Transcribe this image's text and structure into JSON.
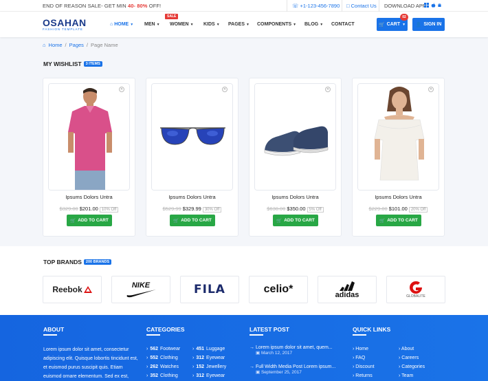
{
  "topbar": {
    "promo_prefix": "END OF REASON SALE- GET MIN",
    "promo_min": "40-",
    "promo_max": "80%",
    "promo_suffix": "OFF!",
    "phone": "+1-123-456-7890",
    "contact": "Contact Us",
    "download": "DOWNLOAD APP"
  },
  "header": {
    "logo_name": "OSAHAN",
    "logo_tag": "FASHION TEMPLATE",
    "nav": [
      "HOME",
      "MEN",
      "WOMEN",
      "KIDS",
      "PAGES",
      "COMPONENTS",
      "BLOG",
      "CONTACT"
    ],
    "sale_badge": "SALE",
    "cart_label": "CART",
    "cart_count": "02",
    "signin_label": "SIGN IN"
  },
  "breadcrumb": [
    "Home",
    "Pages",
    "Page Name"
  ],
  "wishlist": {
    "title": "MY WISHLIST",
    "count": "3 ITEMS",
    "products": [
      {
        "title": "Ipsums Dolors Untra",
        "old_price": "$329.00",
        "price": "$201.00",
        "discount": "10% Off",
        "image": "pink-polo-shirt"
      },
      {
        "title": "Ipsums Dolors Untra",
        "old_price": "$529.99",
        "price": "$329.99",
        "discount": "30% Off",
        "image": "blue-sunglasses"
      },
      {
        "title": "Ipsums Dolors Untra",
        "old_price": "$630.00",
        "price": "$350.00",
        "discount": "5% Off",
        "image": "navy-shoes"
      },
      {
        "title": "Ipsums Dolors Untra",
        "old_price": "$229.00",
        "price": "$101.00",
        "discount": "20% Off",
        "image": "white-off-shoulder-top"
      }
    ],
    "add_to_cart": "ADD TO CART"
  },
  "brands": {
    "title": "TOP BRANDS",
    "count": "200 BRANDS",
    "items": [
      "Reebok",
      "NIKE",
      "FILA",
      "celio*",
      "adidas",
      "GLOBALITE"
    ]
  },
  "footer": {
    "about_title": "ABOUT",
    "about_text": "Lorem ipsum dolor sit amet, consectetur adipiscing elit. Quisque lobortis tincidunt est, et euismod purus suscipit quis. Etiam euismod ornare elementum. Sed ex est,",
    "categories_title": "CATEGORIES",
    "categories": [
      {
        "count": "562",
        "name": "Footwear"
      },
      {
        "count": "451",
        "name": "Luggage"
      },
      {
        "count": "552",
        "name": "Clothing"
      },
      {
        "count": "312",
        "name": "Eyewear"
      },
      {
        "count": "262",
        "name": "Watches"
      },
      {
        "count": "152",
        "name": "Jewellery"
      },
      {
        "count": "352",
        "name": "Clothing"
      },
      {
        "count": "312",
        "name": "Eyewear"
      }
    ],
    "latest_title": "LATEST POST",
    "posts": [
      {
        "title": "Lorem ipsum dolor sit amet, quem...",
        "date": "March 12, 2017"
      },
      {
        "title": "Full Width Media Post Lorem ipsum...",
        "date": "September 25, 2017"
      }
    ],
    "quick_title": "QUICK LINKS",
    "quick_links": [
      "Home",
      "About",
      "FAQ",
      "Careers",
      "Discount",
      "Categories",
      "Returns",
      "Team"
    ]
  },
  "colors": {
    "accent": "#1a73e8",
    "sale_red": "#e53935",
    "cart_green": "#28a745"
  }
}
